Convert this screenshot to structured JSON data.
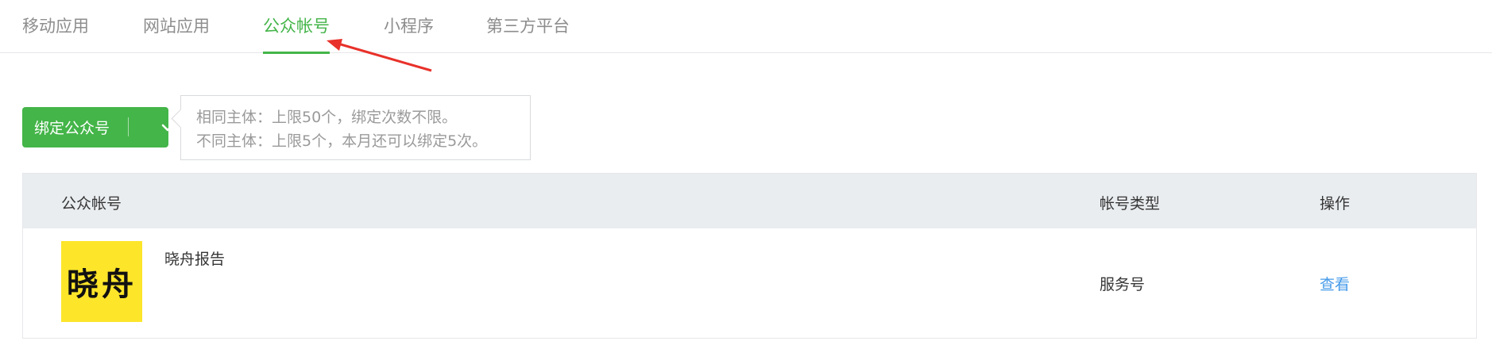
{
  "tabs": [
    {
      "label": "移动应用",
      "active": false
    },
    {
      "label": "网站应用",
      "active": false
    },
    {
      "label": "公众帐号",
      "active": true
    },
    {
      "label": "小程序",
      "active": false
    },
    {
      "label": "第三方平台",
      "active": false
    }
  ],
  "bind_button": {
    "label": "绑定公众号",
    "icon": "chevron-down-icon"
  },
  "tooltip": {
    "line1": "相同主体：上限50个，绑定次数不限。",
    "line2": "不同主体：上限5个，本月还可以绑定5次。"
  },
  "table": {
    "headers": {
      "name": "公众帐号",
      "type": "帐号类型",
      "action": "操作"
    },
    "rows": [
      {
        "logo_text": "晓舟",
        "name": "晓舟报告",
        "type": "服务号",
        "action": "查看"
      }
    ]
  },
  "colors": {
    "accent": "#44b549",
    "link": "#459ae9",
    "header_bg": "#eaedf0",
    "logo_bg": "#fde52a",
    "annotation_arrow": "#e8312a"
  }
}
